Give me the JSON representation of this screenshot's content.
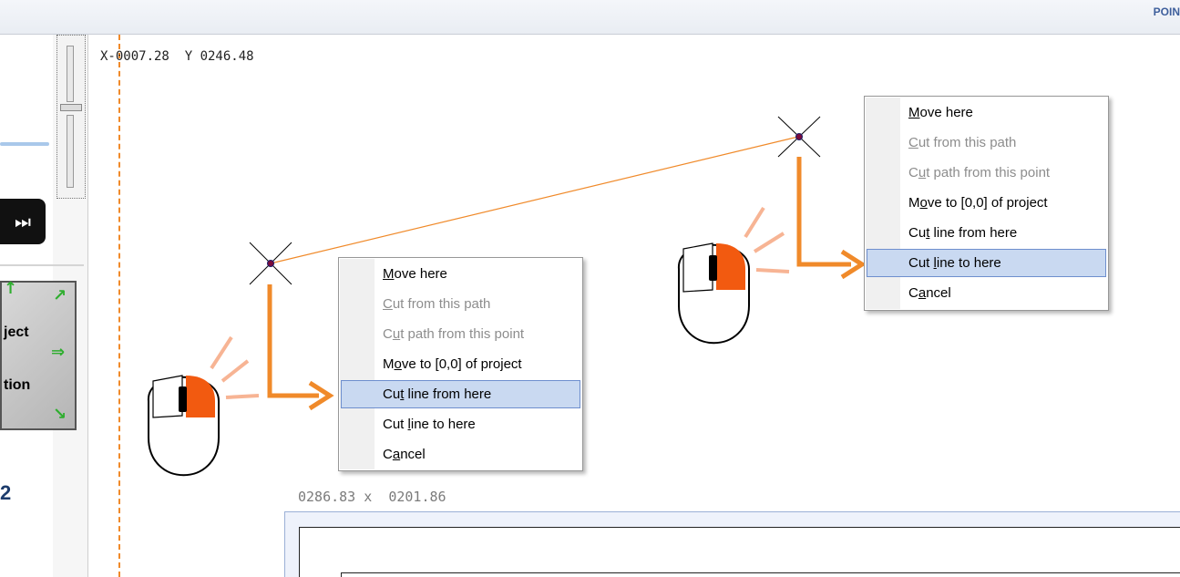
{
  "header": {
    "corner_label": "POIN"
  },
  "left_panel": {
    "skip_button_symbol": "⏭",
    "project_tile": {
      "line1": "ject",
      "line2": "tion"
    },
    "side_digit": "2"
  },
  "canvas": {
    "coordinate_readout": "X-0007.28  Y 0246.48",
    "size_readout": "0286.83 x  0201.86"
  },
  "colors": {
    "accent_orange": "#f08a2a",
    "menu_highlight": "#c9d9f1",
    "menu_highlight_border": "#6e8fce",
    "mouse_right_button": "#f25a10"
  },
  "menus": {
    "left": {
      "items": [
        {
          "pre": "",
          "ul": "M",
          "post": "ove here",
          "disabled": false,
          "active": false
        },
        {
          "pre": "",
          "ul": "C",
          "post": "ut from this path",
          "disabled": true,
          "active": false
        },
        {
          "pre": "C",
          "ul": "u",
          "post": "t path from this point",
          "disabled": true,
          "active": false
        },
        {
          "pre": "M",
          "ul": "o",
          "post": "ve to [0,0] of project",
          "disabled": false,
          "active": false
        },
        {
          "pre": "Cu",
          "ul": "t",
          "post": " line from here",
          "disabled": false,
          "active": true
        },
        {
          "pre": "Cut ",
          "ul": "l",
          "post": "ine to here",
          "disabled": false,
          "active": false
        },
        {
          "pre": "C",
          "ul": "a",
          "post": "ncel",
          "disabled": false,
          "active": false
        }
      ]
    },
    "right": {
      "items": [
        {
          "pre": "",
          "ul": "M",
          "post": "ove here",
          "disabled": false,
          "active": false
        },
        {
          "pre": "",
          "ul": "C",
          "post": "ut from this path",
          "disabled": true,
          "active": false
        },
        {
          "pre": "C",
          "ul": "u",
          "post": "t path from this point",
          "disabled": true,
          "active": false
        },
        {
          "pre": "M",
          "ul": "o",
          "post": "ve to [0,0] of project",
          "disabled": false,
          "active": false
        },
        {
          "pre": "Cu",
          "ul": "t",
          "post": " line from here",
          "disabled": false,
          "active": false
        },
        {
          "pre": "Cut ",
          "ul": "l",
          "post": "ine to here",
          "disabled": false,
          "active": true
        },
        {
          "pre": "C",
          "ul": "a",
          "post": "ncel",
          "disabled": false,
          "active": false
        }
      ]
    }
  }
}
